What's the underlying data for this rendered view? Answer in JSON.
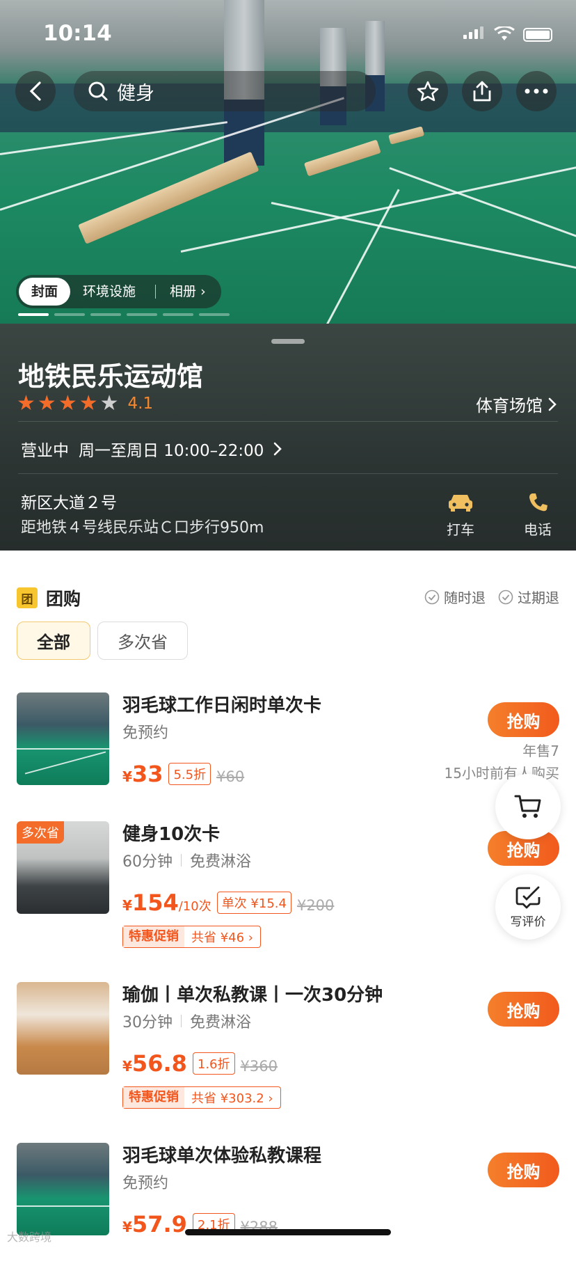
{
  "status_bar": {
    "time": "10:14"
  },
  "top_bar": {
    "search_text": "健身"
  },
  "gallery": {
    "tabs": [
      {
        "label": "封面",
        "active": true
      },
      {
        "label": "环境设施",
        "active": false
      },
      {
        "label": "相册 ›",
        "active": false
      }
    ],
    "slides_total": 6,
    "current_slide": 1
  },
  "venue": {
    "name": "地铁民乐运动馆",
    "rating": "4.1",
    "rating_stars": 4,
    "category": "体育场馆",
    "hours_status": "营业中",
    "hours": "周一至周日 10:00–22:00",
    "address": "新区大道２号",
    "distance": "距地铁４号线民乐站Ｃ口步行950m",
    "actions": [
      {
        "label": "打车",
        "icon": "car-icon"
      },
      {
        "label": "电话",
        "icon": "phone-icon"
      }
    ]
  },
  "group_buy": {
    "icon_text": "团",
    "title": "团购",
    "guarantees": [
      "随时退",
      "过期退"
    ],
    "filters": [
      {
        "label": "全部",
        "active": true
      },
      {
        "label": "多次省",
        "active": false
      }
    ],
    "deals": [
      {
        "title": "羽毛球工作日闲时单次卡",
        "sub": [
          "免预约"
        ],
        "price": "33",
        "unit": "",
        "discount": "5.5折",
        "original": "¥60",
        "button": "抢购",
        "sold": "年售7",
        "recent": "15小时前有人购买"
      },
      {
        "tag": "多次省",
        "title": "健身10次卡",
        "sub": [
          "60分钟",
          "免费淋浴"
        ],
        "price": "154",
        "unit": "/10次",
        "discount": "单次 ¥15.4",
        "original": "¥200",
        "promo_label": "特惠促销",
        "promo_value": "共省 ¥46 ›",
        "button": "抢购"
      },
      {
        "title": "瑜伽丨单次私教课丨一次30分钟",
        "sub": [
          "30分钟",
          "免费淋浴"
        ],
        "price": "56.8",
        "unit": "",
        "discount": "1.6折",
        "original": "¥360",
        "promo_label": "特惠促销",
        "promo_value": "共省 ¥303.2 ›",
        "button": "抢购"
      },
      {
        "title": "羽毛球单次体验私教课程",
        "sub": [
          "免预约"
        ],
        "price": "57.9",
        "unit": "",
        "discount": "2.1折",
        "original": "¥288",
        "button": "抢购"
      }
    ]
  },
  "floating": {
    "cart_icon": "cart-icon",
    "review_label": "写评价"
  },
  "watermark": "大数跨境",
  "colors": {
    "accent": "#f25a1d",
    "rating": "#f46c2a",
    "tuan_icon": "#f7c62f"
  }
}
